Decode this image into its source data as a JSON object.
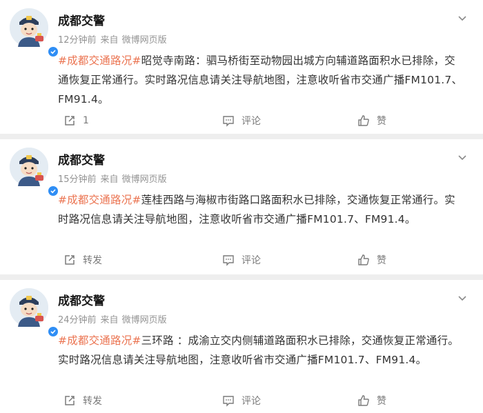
{
  "posts": [
    {
      "author": "成都交警",
      "time": "12分钟前",
      "source_label": "来自",
      "client": "微博网页版",
      "hashtag": "#成都交通路况#",
      "text": "昭觉寺南路：驷马桥街至动物园出城方向辅道路面积水已排除，交通恢复正常通行。实时路况信息请关注导航地图，注意收听省市交通广播FM101.7、FM91.4。",
      "share_label": "1",
      "comment_label": "评论",
      "like_label": "赞"
    },
    {
      "author": "成都交警",
      "time": "15分钟前",
      "source_label": "来自",
      "client": "微博网页版",
      "hashtag": "#成都交通路况#",
      "text": "莲桂西路与海椒市街路口路面积水已排除，交通恢复正常通行。实时路况信息请关注导航地图，注意收听省市交通广播FM101.7、FM91.4。",
      "share_label": "转发",
      "comment_label": "评论",
      "like_label": "赞"
    },
    {
      "author": "成都交警",
      "time": "24分钟前",
      "source_label": "来自",
      "client": "微博网页版",
      "hashtag": "#成都交通路况#",
      "text": "三环路 ：成渝立交内侧辅道路面积水已排除，交通恢复正常通行。实时路况信息请关注导航地图，注意收听省市交通广播FM101.7、FM91.4。",
      "share_label": "转发",
      "comment_label": "评论",
      "like_label": "赞"
    }
  ],
  "icons": {
    "avatar": "police-mascot-avatar",
    "verified": "verified-badge-icon",
    "menu": "chevron-down-icon",
    "share": "share-icon",
    "comment": "comment-icon",
    "like": "thumbs-up-icon"
  },
  "colors": {
    "hashtag": "#eb7350",
    "verified": "#2f8ef5",
    "meta": "#939393",
    "action": "#7a7a7a"
  }
}
